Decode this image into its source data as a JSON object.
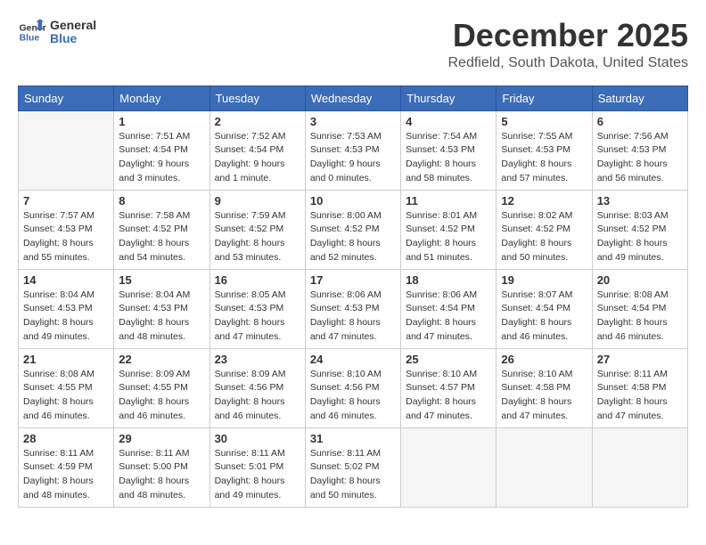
{
  "header": {
    "logo_line1": "General",
    "logo_line2": "Blue",
    "month": "December 2025",
    "location": "Redfield, South Dakota, United States"
  },
  "days_of_week": [
    "Sunday",
    "Monday",
    "Tuesday",
    "Wednesday",
    "Thursday",
    "Friday",
    "Saturday"
  ],
  "weeks": [
    [
      {
        "day": "",
        "info": ""
      },
      {
        "day": "1",
        "info": "Sunrise: 7:51 AM\nSunset: 4:54 PM\nDaylight: 9 hours\nand 3 minutes."
      },
      {
        "day": "2",
        "info": "Sunrise: 7:52 AM\nSunset: 4:54 PM\nDaylight: 9 hours\nand 1 minute."
      },
      {
        "day": "3",
        "info": "Sunrise: 7:53 AM\nSunset: 4:53 PM\nDaylight: 9 hours\nand 0 minutes."
      },
      {
        "day": "4",
        "info": "Sunrise: 7:54 AM\nSunset: 4:53 PM\nDaylight: 8 hours\nand 58 minutes."
      },
      {
        "day": "5",
        "info": "Sunrise: 7:55 AM\nSunset: 4:53 PM\nDaylight: 8 hours\nand 57 minutes."
      },
      {
        "day": "6",
        "info": "Sunrise: 7:56 AM\nSunset: 4:53 PM\nDaylight: 8 hours\nand 56 minutes."
      }
    ],
    [
      {
        "day": "7",
        "info": "Sunrise: 7:57 AM\nSunset: 4:53 PM\nDaylight: 8 hours\nand 55 minutes."
      },
      {
        "day": "8",
        "info": "Sunrise: 7:58 AM\nSunset: 4:52 PM\nDaylight: 8 hours\nand 54 minutes."
      },
      {
        "day": "9",
        "info": "Sunrise: 7:59 AM\nSunset: 4:52 PM\nDaylight: 8 hours\nand 53 minutes."
      },
      {
        "day": "10",
        "info": "Sunrise: 8:00 AM\nSunset: 4:52 PM\nDaylight: 8 hours\nand 52 minutes."
      },
      {
        "day": "11",
        "info": "Sunrise: 8:01 AM\nSunset: 4:52 PM\nDaylight: 8 hours\nand 51 minutes."
      },
      {
        "day": "12",
        "info": "Sunrise: 8:02 AM\nSunset: 4:52 PM\nDaylight: 8 hours\nand 50 minutes."
      },
      {
        "day": "13",
        "info": "Sunrise: 8:03 AM\nSunset: 4:52 PM\nDaylight: 8 hours\nand 49 minutes."
      }
    ],
    [
      {
        "day": "14",
        "info": "Sunrise: 8:04 AM\nSunset: 4:53 PM\nDaylight: 8 hours\nand 49 minutes."
      },
      {
        "day": "15",
        "info": "Sunrise: 8:04 AM\nSunset: 4:53 PM\nDaylight: 8 hours\nand 48 minutes."
      },
      {
        "day": "16",
        "info": "Sunrise: 8:05 AM\nSunset: 4:53 PM\nDaylight: 8 hours\nand 47 minutes."
      },
      {
        "day": "17",
        "info": "Sunrise: 8:06 AM\nSunset: 4:53 PM\nDaylight: 8 hours\nand 47 minutes."
      },
      {
        "day": "18",
        "info": "Sunrise: 8:06 AM\nSunset: 4:54 PM\nDaylight: 8 hours\nand 47 minutes."
      },
      {
        "day": "19",
        "info": "Sunrise: 8:07 AM\nSunset: 4:54 PM\nDaylight: 8 hours\nand 46 minutes."
      },
      {
        "day": "20",
        "info": "Sunrise: 8:08 AM\nSunset: 4:54 PM\nDaylight: 8 hours\nand 46 minutes."
      }
    ],
    [
      {
        "day": "21",
        "info": "Sunrise: 8:08 AM\nSunset: 4:55 PM\nDaylight: 8 hours\nand 46 minutes."
      },
      {
        "day": "22",
        "info": "Sunrise: 8:09 AM\nSunset: 4:55 PM\nDaylight: 8 hours\nand 46 minutes."
      },
      {
        "day": "23",
        "info": "Sunrise: 8:09 AM\nSunset: 4:56 PM\nDaylight: 8 hours\nand 46 minutes."
      },
      {
        "day": "24",
        "info": "Sunrise: 8:10 AM\nSunset: 4:56 PM\nDaylight: 8 hours\nand 46 minutes."
      },
      {
        "day": "25",
        "info": "Sunrise: 8:10 AM\nSunset: 4:57 PM\nDaylight: 8 hours\nand 47 minutes."
      },
      {
        "day": "26",
        "info": "Sunrise: 8:10 AM\nSunset: 4:58 PM\nDaylight: 8 hours\nand 47 minutes."
      },
      {
        "day": "27",
        "info": "Sunrise: 8:11 AM\nSunset: 4:58 PM\nDaylight: 8 hours\nand 47 minutes."
      }
    ],
    [
      {
        "day": "28",
        "info": "Sunrise: 8:11 AM\nSunset: 4:59 PM\nDaylight: 8 hours\nand 48 minutes."
      },
      {
        "day": "29",
        "info": "Sunrise: 8:11 AM\nSunset: 5:00 PM\nDaylight: 8 hours\nand 48 minutes."
      },
      {
        "day": "30",
        "info": "Sunrise: 8:11 AM\nSunset: 5:01 PM\nDaylight: 8 hours\nand 49 minutes."
      },
      {
        "day": "31",
        "info": "Sunrise: 8:11 AM\nSunset: 5:02 PM\nDaylight: 8 hours\nand 50 minutes."
      },
      {
        "day": "",
        "info": ""
      },
      {
        "day": "",
        "info": ""
      },
      {
        "day": "",
        "info": ""
      }
    ]
  ]
}
